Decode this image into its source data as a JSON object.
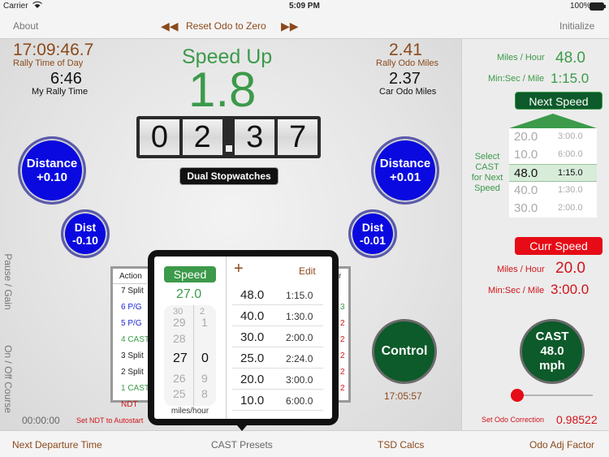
{
  "status": {
    "carrier": "Carrier",
    "time": "5:09 PM",
    "battery": "100%"
  },
  "nav": {
    "about": "About",
    "reset": "Reset Odo to Zero",
    "initialize": "Initialize"
  },
  "rally": {
    "time_of_day": "17:09:46.7",
    "time_of_day_label": "Rally Time of Day",
    "my_time": "6:46",
    "my_time_label": "My Rally Time",
    "speed_status": "Speed Up",
    "speed_value": "1.8",
    "odo_miles": "2.41",
    "odo_miles_label": "Rally Odo Miles",
    "car_miles": "2.37",
    "car_miles_label": "Car Odo Miles",
    "odometer_digits": [
      "0",
      "2",
      "3",
      "7"
    ],
    "dual_stopwatches": "Dual Stopwatches"
  },
  "buttons": {
    "distance_plus_010": [
      "Distance",
      "+0.10"
    ],
    "dist_minus_010": [
      "Dist",
      "-0.10"
    ],
    "distance_plus_001": [
      "Distance",
      "+0.01"
    ],
    "dist_minus_001": [
      "Dist",
      "-0.01"
    ],
    "control": "Control",
    "control_time": "17:05:57",
    "cast": [
      "CAST",
      "48.0",
      "mph"
    ]
  },
  "side_labels": {
    "pause_gain": "Pause / Gain",
    "on_off_course": "On / Off Course"
  },
  "bottom": {
    "ndt_time": "00:00:00",
    "ndt_label": "Set NDT to Autostart",
    "odo_corr_label": "Set Odo Correction",
    "odo_corr_value": "0.98522"
  },
  "table": {
    "header": "Action",
    "rows": [
      {
        "label": "7 Split",
        "color": "#222"
      },
      {
        "label": "6 P/G",
        "color": "#1e2ad0"
      },
      {
        "label": "5 P/G",
        "color": "#1e2ad0"
      },
      {
        "label": "4 CAST",
        "color": "#3c9a4a"
      },
      {
        "label": "3 Split",
        "color": "#222"
      },
      {
        "label": "2 Split",
        "color": "#222"
      },
      {
        "label": "1 CAST",
        "color": "#3c9a4a"
      },
      {
        "label": "NDT",
        "color": "#d0141a"
      }
    ],
    "right_header": "r",
    "right_col": [
      "3",
      "2",
      "2",
      "2",
      "2",
      "2"
    ]
  },
  "popover": {
    "speed_btn": "Speed",
    "speed_value": "27.0",
    "picker_left": [
      "29",
      "28",
      "27",
      "26",
      "25"
    ],
    "picker_right": [
      "1",
      "0",
      "9",
      "8"
    ],
    "picker_top_left": "30",
    "picker_top_right": "2",
    "picker_selected_left": "27",
    "picker_selected_right": "0",
    "picker_unit": "miles/hour",
    "add": "+",
    "edit": "Edit",
    "presets": [
      {
        "speed": "48.0",
        "pace": "1:15.0"
      },
      {
        "speed": "40.0",
        "pace": "1:30.0"
      },
      {
        "speed": "30.0",
        "pace": "2:00.0"
      },
      {
        "speed": "25.0",
        "pace": "2:24.0"
      },
      {
        "speed": "20.0",
        "pace": "3:00.0"
      },
      {
        "speed": "10.0",
        "pace": "6:00.0"
      }
    ]
  },
  "right": {
    "mph_label": "Miles / Hour",
    "mph_value": "48.0",
    "pace_label": "Min:Sec / Mile",
    "pace_value": "1:15.0",
    "next_speed": "Next Speed",
    "select_label": [
      "Select",
      "CAST",
      "for Next",
      "Speed"
    ],
    "cast_list": [
      {
        "speed": "20.0",
        "pace": "3:00.0"
      },
      {
        "speed": "10.0",
        "pace": "6:00.0"
      },
      {
        "speed": "48.0",
        "pace": "1:15.0"
      },
      {
        "speed": "40.0",
        "pace": "1:30.0"
      },
      {
        "speed": "30.0",
        "pace": "2:00.0"
      }
    ],
    "curr_speed": "Curr Speed",
    "curr_mph_label": "Miles / Hour",
    "curr_mph_value": "20.0",
    "curr_pace_label": "Min:Sec / Mile",
    "curr_pace_value": "3:00.0"
  },
  "tabs": {
    "next_departure": "Next Departure Time",
    "cast_presets": "CAST Presets",
    "tsd_calcs": "TSD Calcs",
    "odo_adj": "Odo Adj Factor"
  }
}
